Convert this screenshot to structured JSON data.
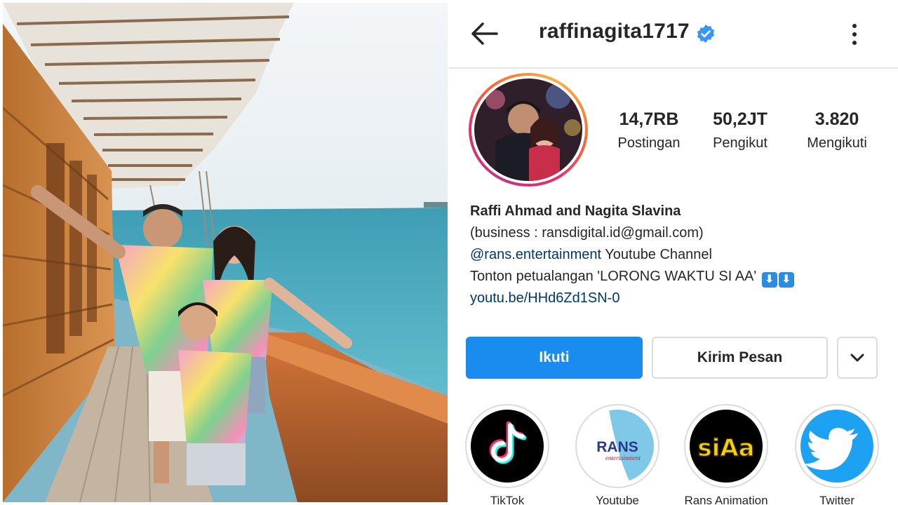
{
  "profile": {
    "username": "raffinagita1717",
    "verified": true,
    "stats": {
      "posts_value": "14,7RB",
      "posts_label": "Postingan",
      "followers_value": "50,2JT",
      "followers_label": "Pengikut",
      "following_value": "3.820",
      "following_label": "Mengikuti"
    },
    "bio": {
      "name": "Raffi Ahmad and Nagita Slavina",
      "line1": "(business : ransdigital.id@gmail.com)",
      "mention": "@rans.entertainment",
      "line2_rest": " Youtube Channel",
      "line3": "Tonton petualangan 'LORONG WAKTU SI AA'",
      "arrow_glyph": "⬇",
      "link": "youtu.be/HHd6Zd1SN-0"
    },
    "buttons": {
      "follow": "Ikuti",
      "message": "Kirim Pesan"
    },
    "highlights": [
      {
        "label": "TikTok",
        "icon": "tiktok-icon"
      },
      {
        "label": "Youtube",
        "icon": "rans-entertainment-logo"
      },
      {
        "label": "Rans Animation",
        "icon": "siaa-logo"
      },
      {
        "label": "Twitter",
        "icon": "twitter-bird-icon"
      }
    ],
    "highlight_logo_texts": {
      "rans": "RANS",
      "rans_sub": "entertainment",
      "siaa": "siAa"
    }
  },
  "colors": {
    "follow_button": "#1a8cf0",
    "link": "#00376b",
    "verified": "#3897f0",
    "twitter": "#1da1f2"
  }
}
